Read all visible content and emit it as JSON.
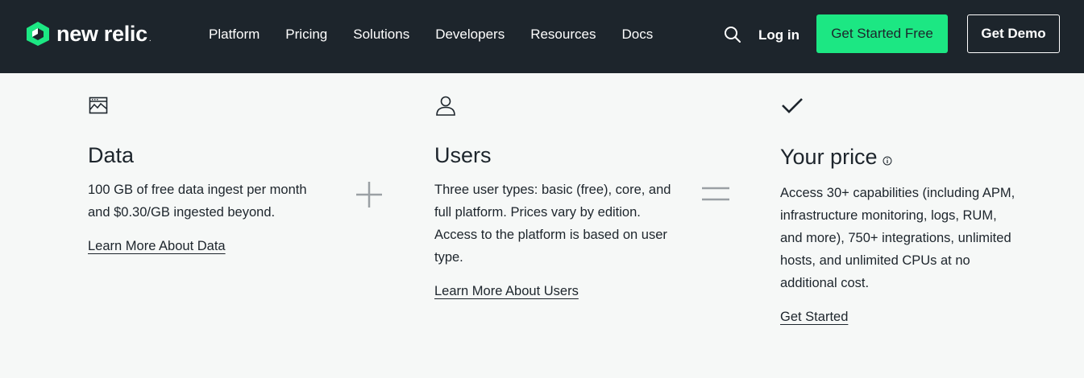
{
  "header": {
    "logo_text": "new relic",
    "nav": [
      "Platform",
      "Pricing",
      "Solutions",
      "Developers",
      "Resources",
      "Docs"
    ],
    "search_icon": "search-icon",
    "login_label": "Log in",
    "cta_primary": "Get Started Free",
    "cta_secondary": "Get Demo",
    "colors": {
      "bar": "#1d252c",
      "accent": "#1ce783"
    }
  },
  "pricing": {
    "data": {
      "icon": "chart-window-icon",
      "title": "Data",
      "text": "100 GB of free data ingest per month and $0.30/GB ingested beyond.",
      "link": "Learn More About Data"
    },
    "operator_1": "plus-icon",
    "users": {
      "icon": "user-icon",
      "title": "Users",
      "text": "Three user types: basic (free), core, and full platform. Prices vary by edition. Access to the platform is based on user type.",
      "link": "Learn More About Users"
    },
    "operator_2": "equals-icon",
    "price": {
      "icon": "checkmark-icon",
      "title": "Your price",
      "info_icon": "info-icon",
      "text": "Access 30+ capabilities (including APM, infrastructure monitoring, logs, RUM, and more), 750+ integrations, unlimited hosts, and unlimited CPUs at no additional cost.",
      "link": "Get Started"
    }
  }
}
